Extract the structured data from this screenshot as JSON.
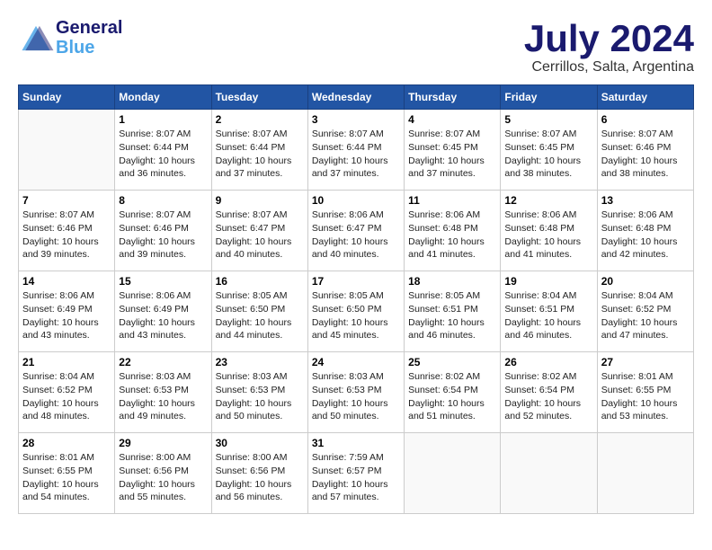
{
  "header": {
    "logo_line1": "General",
    "logo_line2": "Blue",
    "month_year": "July 2024",
    "location": "Cerrillos, Salta, Argentina"
  },
  "days_of_week": [
    "Sunday",
    "Monday",
    "Tuesday",
    "Wednesday",
    "Thursday",
    "Friday",
    "Saturday"
  ],
  "weeks": [
    [
      {
        "day": "",
        "info": ""
      },
      {
        "day": "1",
        "info": "Sunrise: 8:07 AM\nSunset: 6:44 PM\nDaylight: 10 hours\nand 36 minutes."
      },
      {
        "day": "2",
        "info": "Sunrise: 8:07 AM\nSunset: 6:44 PM\nDaylight: 10 hours\nand 37 minutes."
      },
      {
        "day": "3",
        "info": "Sunrise: 8:07 AM\nSunset: 6:44 PM\nDaylight: 10 hours\nand 37 minutes."
      },
      {
        "day": "4",
        "info": "Sunrise: 8:07 AM\nSunset: 6:45 PM\nDaylight: 10 hours\nand 37 minutes."
      },
      {
        "day": "5",
        "info": "Sunrise: 8:07 AM\nSunset: 6:45 PM\nDaylight: 10 hours\nand 38 minutes."
      },
      {
        "day": "6",
        "info": "Sunrise: 8:07 AM\nSunset: 6:46 PM\nDaylight: 10 hours\nand 38 minutes."
      }
    ],
    [
      {
        "day": "7",
        "info": "Sunrise: 8:07 AM\nSunset: 6:46 PM\nDaylight: 10 hours\nand 39 minutes."
      },
      {
        "day": "8",
        "info": "Sunrise: 8:07 AM\nSunset: 6:46 PM\nDaylight: 10 hours\nand 39 minutes."
      },
      {
        "day": "9",
        "info": "Sunrise: 8:07 AM\nSunset: 6:47 PM\nDaylight: 10 hours\nand 40 minutes."
      },
      {
        "day": "10",
        "info": "Sunrise: 8:06 AM\nSunset: 6:47 PM\nDaylight: 10 hours\nand 40 minutes."
      },
      {
        "day": "11",
        "info": "Sunrise: 8:06 AM\nSunset: 6:48 PM\nDaylight: 10 hours\nand 41 minutes."
      },
      {
        "day": "12",
        "info": "Sunrise: 8:06 AM\nSunset: 6:48 PM\nDaylight: 10 hours\nand 41 minutes."
      },
      {
        "day": "13",
        "info": "Sunrise: 8:06 AM\nSunset: 6:48 PM\nDaylight: 10 hours\nand 42 minutes."
      }
    ],
    [
      {
        "day": "14",
        "info": "Sunrise: 8:06 AM\nSunset: 6:49 PM\nDaylight: 10 hours\nand 43 minutes."
      },
      {
        "day": "15",
        "info": "Sunrise: 8:06 AM\nSunset: 6:49 PM\nDaylight: 10 hours\nand 43 minutes."
      },
      {
        "day": "16",
        "info": "Sunrise: 8:05 AM\nSunset: 6:50 PM\nDaylight: 10 hours\nand 44 minutes."
      },
      {
        "day": "17",
        "info": "Sunrise: 8:05 AM\nSunset: 6:50 PM\nDaylight: 10 hours\nand 45 minutes."
      },
      {
        "day": "18",
        "info": "Sunrise: 8:05 AM\nSunset: 6:51 PM\nDaylight: 10 hours\nand 46 minutes."
      },
      {
        "day": "19",
        "info": "Sunrise: 8:04 AM\nSunset: 6:51 PM\nDaylight: 10 hours\nand 46 minutes."
      },
      {
        "day": "20",
        "info": "Sunrise: 8:04 AM\nSunset: 6:52 PM\nDaylight: 10 hours\nand 47 minutes."
      }
    ],
    [
      {
        "day": "21",
        "info": "Sunrise: 8:04 AM\nSunset: 6:52 PM\nDaylight: 10 hours\nand 48 minutes."
      },
      {
        "day": "22",
        "info": "Sunrise: 8:03 AM\nSunset: 6:53 PM\nDaylight: 10 hours\nand 49 minutes."
      },
      {
        "day": "23",
        "info": "Sunrise: 8:03 AM\nSunset: 6:53 PM\nDaylight: 10 hours\nand 50 minutes."
      },
      {
        "day": "24",
        "info": "Sunrise: 8:03 AM\nSunset: 6:53 PM\nDaylight: 10 hours\nand 50 minutes."
      },
      {
        "day": "25",
        "info": "Sunrise: 8:02 AM\nSunset: 6:54 PM\nDaylight: 10 hours\nand 51 minutes."
      },
      {
        "day": "26",
        "info": "Sunrise: 8:02 AM\nSunset: 6:54 PM\nDaylight: 10 hours\nand 52 minutes."
      },
      {
        "day": "27",
        "info": "Sunrise: 8:01 AM\nSunset: 6:55 PM\nDaylight: 10 hours\nand 53 minutes."
      }
    ],
    [
      {
        "day": "28",
        "info": "Sunrise: 8:01 AM\nSunset: 6:55 PM\nDaylight: 10 hours\nand 54 minutes."
      },
      {
        "day": "29",
        "info": "Sunrise: 8:00 AM\nSunset: 6:56 PM\nDaylight: 10 hours\nand 55 minutes."
      },
      {
        "day": "30",
        "info": "Sunrise: 8:00 AM\nSunset: 6:56 PM\nDaylight: 10 hours\nand 56 minutes."
      },
      {
        "day": "31",
        "info": "Sunrise: 7:59 AM\nSunset: 6:57 PM\nDaylight: 10 hours\nand 57 minutes."
      },
      {
        "day": "",
        "info": ""
      },
      {
        "day": "",
        "info": ""
      },
      {
        "day": "",
        "info": ""
      }
    ]
  ]
}
